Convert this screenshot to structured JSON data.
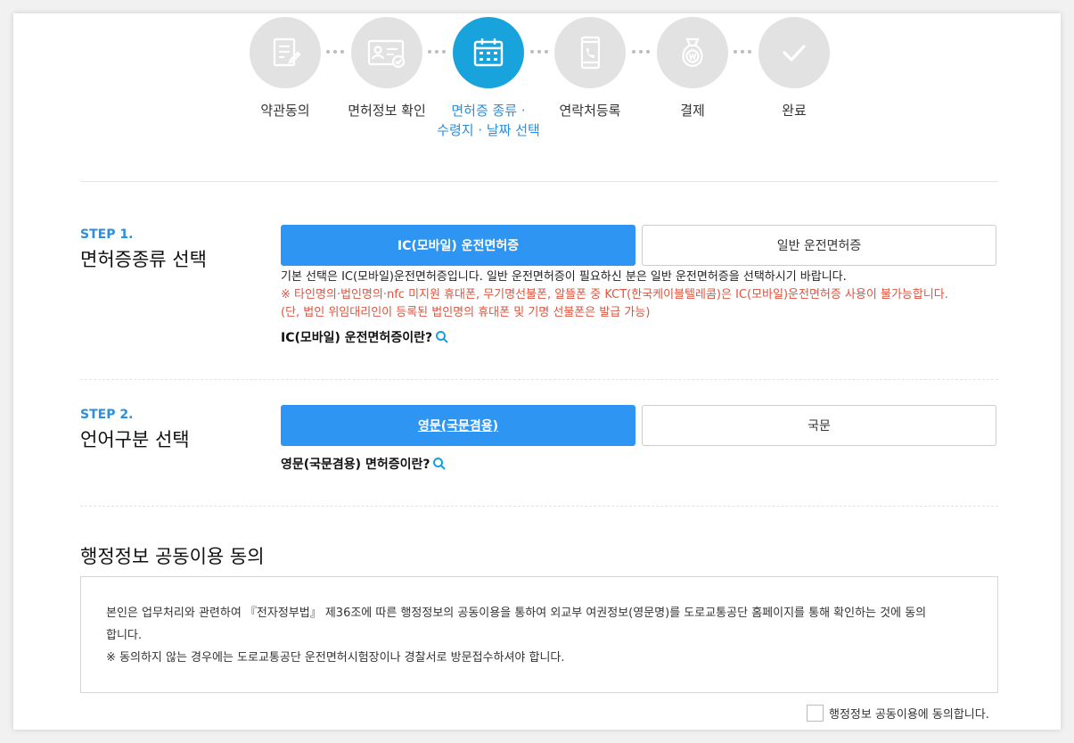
{
  "stepper": {
    "steps": [
      {
        "label": "약관동의",
        "icon": "document-edit-icon"
      },
      {
        "label": "면허정보 확인",
        "icon": "license-card-icon"
      },
      {
        "label": "면허증 종류 ·",
        "label2": "수령지 · 날짜 선택",
        "icon": "calendar-icon",
        "active": true
      },
      {
        "label": "연락처등록",
        "icon": "mobile-phone-icon"
      },
      {
        "label": "결제",
        "icon": "money-bag-icon"
      },
      {
        "label": "완료",
        "icon": "check-icon"
      }
    ]
  },
  "step1": {
    "number": "STEP 1.",
    "title": "면허증종류 선택",
    "option_selected": "IC(모바일) 운전면허증",
    "option_other": "일반 운전면허증",
    "desc_line1": "기본 선택은 IC(모바일)운전면허증입니다. 일반 운전면허증이 필요하신 분은 일반 운전면허증을 선택하시기 바랍니다.",
    "desc_line2": "※ 타인명의·법인명의·nfc 미지원 휴대폰, 무기명선불폰, 알뜰폰 중 KCT(한국케이블텔레콤)은 IC(모바일)운전면허증 사용이 불가능합니다.",
    "desc_line3": "(단, 법인 위임대리인이 등록된 법인명의 휴대폰 및 기명 선불폰은 발급 가능)",
    "help_link": "IC(모바일) 운전면허증이란?"
  },
  "step2": {
    "number": "STEP 2.",
    "title": "언어구분 선택",
    "option_selected": "영문(국문겸용)",
    "option_other": "국문",
    "help_link": "영문(국문겸용) 면허증이란?"
  },
  "consent": {
    "title": "행정정보 공동이용 동의",
    "text_line1": "본인은 업무처리와 관련하여 『전자정부법』 제36조에 따른 행정정보의 공동이용을 통하여 외교부 여권정보(영문명)를 도로교통공단 홈페이지를 통해 확인하는 것에 동의",
    "text_line2": "합니다.",
    "text_line3": "※ 동의하지 않는 경우에는 도로교통공단 운전면허시험장이나 경찰서로 방문접수하셔야 합니다.",
    "checkbox_label": "행정정보 공동이용에 동의합니다."
  },
  "colors": {
    "accent": "#2f95f2",
    "active_step": "#19a3dd",
    "warning": "#e2533d",
    "link_blue": "#2b8fde"
  }
}
